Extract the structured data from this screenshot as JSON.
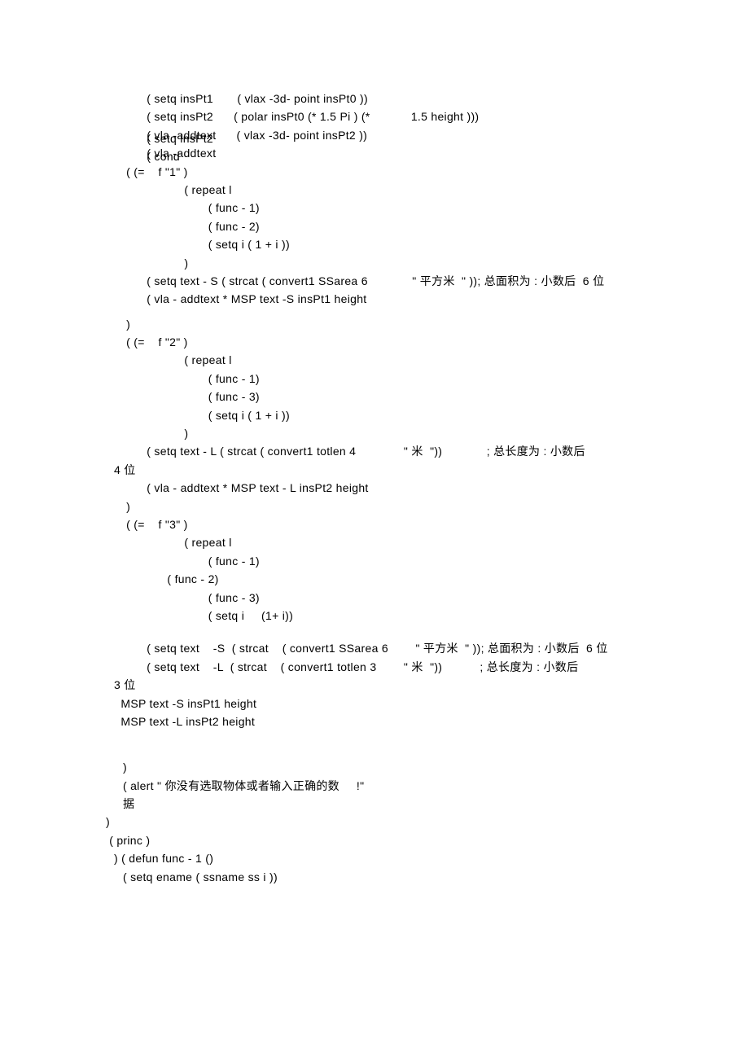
{
  "code": {
    "l01": "            ( setq insPt1       ( vlax -3d- point insPt0 ))",
    "l02": "            ( setq insPt2      ( polar insPt0 (* 1.5 Pi ) (*            1.5 height )))",
    "l03a": "            ( vla -addtext      ( vlax -3d- point insPt2 ))",
    "l03b": "            ( setq insPt2",
    "l04a": "            ( vla -addtext",
    "l04b": "            ( cond",
    "l05": "      ( (=    f \"1\" )",
    "l06": "                       ( repeat l",
    "l07": "                              ( func - 1)",
    "l08": "                              ( func - 2)",
    "l09": "                              ( setq i ( 1 + i ))",
    "l10": "                       )",
    "l11": "            ( setq text - S ( strcat ( convert1 SSarea 6             \" 平方米  \" )); 总面积为 : 小数后  6 位",
    "l12": "            ( vla - addtext * MSP text -S insPt1 height",
    "l13": "      )",
    "l14": "      ( (=    f \"2\" )",
    "l15": "                       ( repeat l",
    "l16": "                              ( func - 1)",
    "l17": "                              ( func - 3)",
    "l18": "                              ( setq i ( 1 + i ))",
    "l19": "                       )",
    "l20": "            ( setq text - L ( strcat ( convert1 totlen 4              \" 米  \"))             ; 总长度为 : 小数后",
    "l21": "4 位",
    "l22": "            ( vla - addtext * MSP text - L insPt2 height",
    "l23": "      )",
    "l24": "      ( (=    f \"3\" )",
    "l25": "                       ( repeat l",
    "l26": "                              ( func - 1)",
    "l27": "                  ( func - 2)",
    "l28": "                              ( func - 3)",
    "l29": "                              ( setq i     (1+ i))",
    "l30": "            ( setq text    -S  ( strcat    ( convert1 SSarea 6        \" 平方米  \" )); 总面积为 : 小数后  6 位",
    "l31": "            ( setq text    -L  ( strcat    ( convert1 totlen 3        \" 米  \"))           ; 总长度为 : 小数后",
    "l32": "3 位",
    "l33": "  MSP text -S insPt1 height",
    "l34": "  MSP text -L insPt2 height",
    "l35": "     )",
    "l36": "     ( alert \" 你没有选取物体或者输入正确的数     !\"",
    "l37": "     据",
    "l38": ")",
    "l39": " ( princ )",
    "l40": ") ( defun func - 1 ()",
    "l41": "     ( setq ename ( ssname ss i ))"
  }
}
